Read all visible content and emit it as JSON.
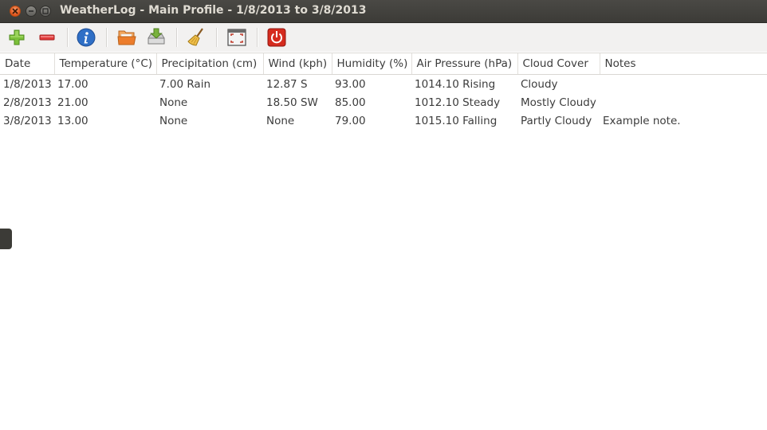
{
  "window": {
    "title": "WeatherLog - Main Profile - 1/8/2013 to 3/8/2013"
  },
  "toolbar": {
    "buttons": [
      {
        "icon": "add-icon",
        "color": "#73b62a"
      },
      {
        "icon": "remove-icon",
        "color": "#e03a3a"
      },
      {
        "icon": "info-icon",
        "color": "#2f6fc6"
      },
      {
        "icon": "open-folder-icon",
        "color": "#e8792b"
      },
      {
        "icon": "import-icon",
        "color": "#6a9e3a"
      },
      {
        "icon": "clear-broom-icon",
        "color": "#e0b33a"
      },
      {
        "icon": "fullscreen-icon",
        "color": "#c23b2b"
      },
      {
        "icon": "power-icon",
        "color": "#d52b1e"
      }
    ]
  },
  "table": {
    "columns": [
      "Date",
      "Temperature (°C)",
      "Precipitation (cm)",
      "Wind (kph)",
      "Humidity (%)",
      "Air Pressure (hPa)",
      "Cloud Cover",
      "Notes"
    ],
    "rows": [
      [
        "1/8/2013",
        "17.00",
        "7.00 Rain",
        "12.87 S",
        "93.00",
        "1014.10 Rising",
        "Cloudy",
        ""
      ],
      [
        "2/8/2013",
        "21.00",
        "None",
        "18.50 SW",
        "85.00",
        "1012.10 Steady",
        "Mostly Cloudy",
        ""
      ],
      [
        "3/8/2013",
        "13.00",
        "None",
        "None",
        "79.00",
        "1015.10 Falling",
        "Partly Cloudy",
        "Example note."
      ]
    ]
  }
}
